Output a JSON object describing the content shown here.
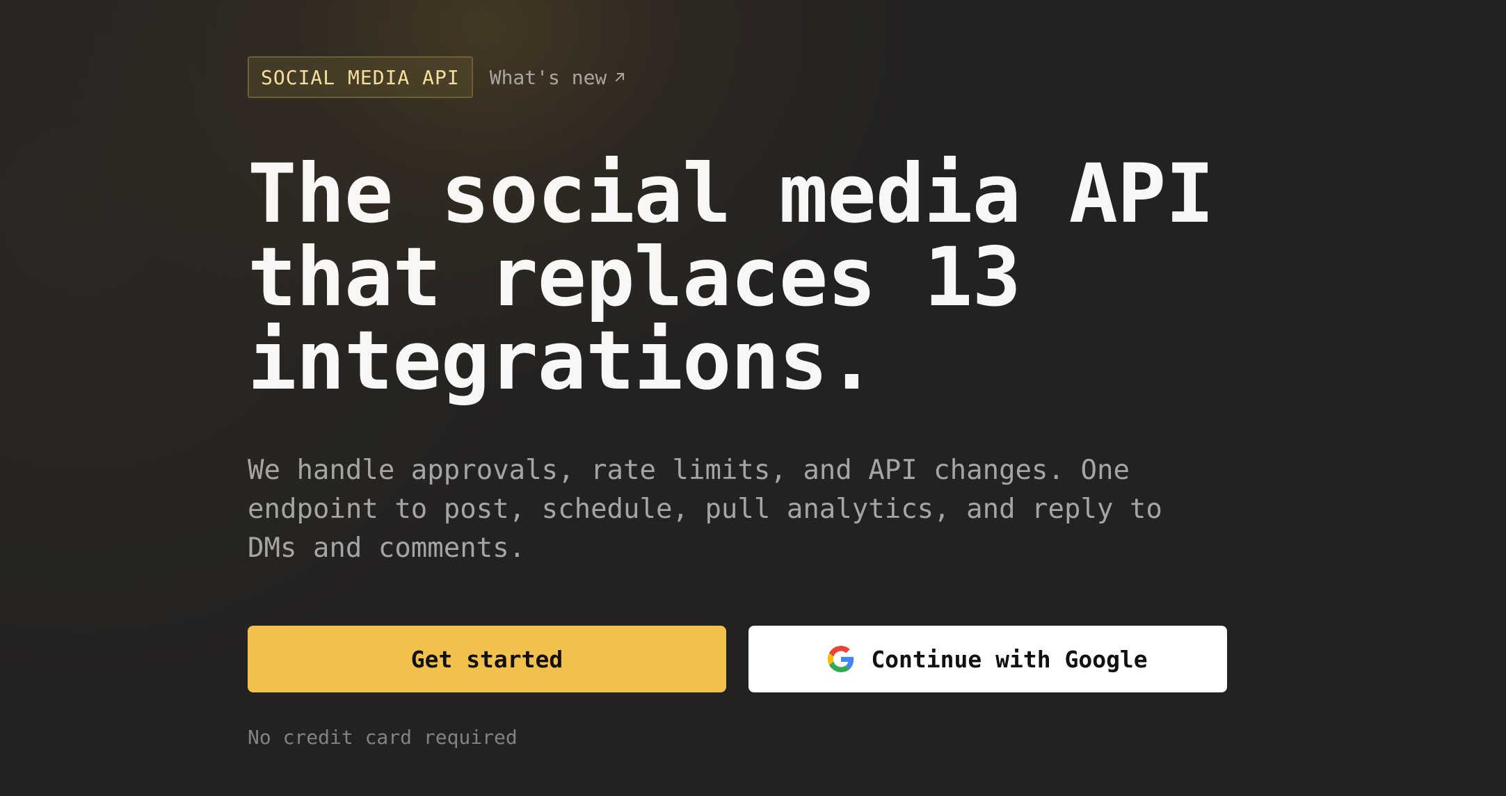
{
  "badge": {
    "label": "SOCIAL MEDIA API"
  },
  "whats_new": {
    "label": "What's new",
    "icon": "arrow-up-right-icon"
  },
  "hero": {
    "headline_lines": [
      "The social media API",
      "that replaces 13",
      "integrations."
    ],
    "subtitle_lines": [
      "We handle approvals, rate limits, and API changes. One",
      "endpoint to post, schedule, pull analytics, and reply to",
      "DMs and comments."
    ]
  },
  "actions": {
    "primary_label": "Get started",
    "google_label": "Continue with Google",
    "google_icon": "google-icon"
  },
  "note": "No credit card required",
  "colors": {
    "background": "#242221",
    "accent": "#f2c04c",
    "badge_text": "#f5e0a0",
    "headline": "#f8f7f5",
    "subtitle": "#a7a5a2"
  }
}
